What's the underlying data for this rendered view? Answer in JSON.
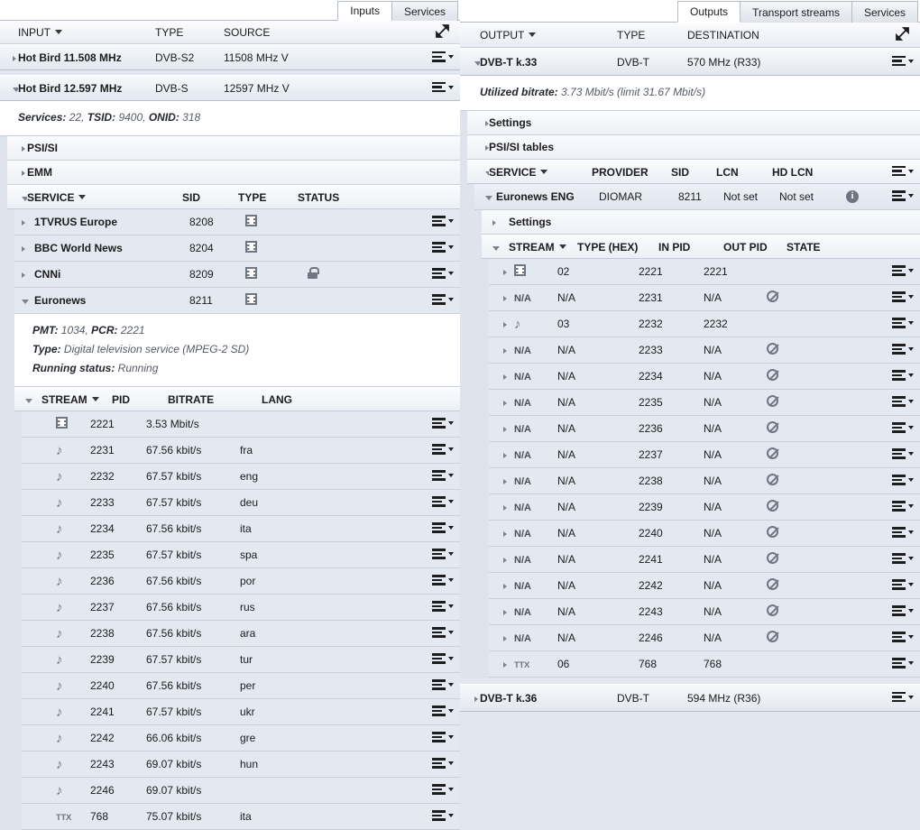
{
  "left": {
    "tabs": [
      {
        "label": "Inputs",
        "active": true
      },
      {
        "label": "Services",
        "active": false
      }
    ],
    "header": {
      "col_input": "INPUT",
      "col_type": "TYPE",
      "col_source": "SOURCE",
      "expand_icon": "expand-diagonal-icon"
    },
    "inputs": [
      {
        "name": "Hot Bird 11.508 MHz",
        "type": "DVB-S2",
        "source": "11508 MHz V",
        "expanded": false
      },
      {
        "name": "Hot Bird 12.597 MHz",
        "type": "DVB-S",
        "source": "12597 MHz V",
        "expanded": true
      }
    ],
    "ts_info": {
      "services_label": "Services:",
      "services_value": "22,",
      "tsid_label": "TSID:",
      "tsid_value": "9400,",
      "onid_label": "ONID:",
      "onid_value": "318"
    },
    "groups": [
      {
        "label": "PSI/SI"
      },
      {
        "label": "EMM"
      }
    ],
    "service_header": {
      "col_service": "SERVICE",
      "col_sid": "SID",
      "col_type": "TYPE",
      "col_status": "STATUS"
    },
    "services": [
      {
        "name": "1TVRUS Europe",
        "sid": "8208",
        "type_icon": "video-film-icon",
        "status_icon": "",
        "expanded": false
      },
      {
        "name": "BBC World News",
        "sid": "8204",
        "type_icon": "video-film-icon",
        "status_icon": "",
        "expanded": false
      },
      {
        "name": "CNNi",
        "sid": "8209",
        "type_icon": "video-film-icon",
        "status_icon": "lock-icon",
        "expanded": false
      },
      {
        "name": "Euronews",
        "sid": "8211",
        "type_icon": "video-film-icon",
        "status_icon": "",
        "expanded": true
      }
    ],
    "service_detail": {
      "pmt_label": "PMT:",
      "pmt_value": "1034,",
      "pcr_label": "PCR:",
      "pcr_value": "2221",
      "type_label": "Type:",
      "type_value": "Digital television service (MPEG-2 SD)",
      "running_label": "Running status:",
      "running_value": "Running"
    },
    "stream_header": {
      "col_stream": "STREAM",
      "col_pid": "PID",
      "col_bitrate": "BITRATE",
      "col_lang": "LANG"
    },
    "streams": [
      {
        "icon": "video-film-icon",
        "pid": "2221",
        "bitrate": "3.53 Mbit/s",
        "lang": ""
      },
      {
        "icon": "audio-note-icon",
        "pid": "2231",
        "bitrate": "67.56 kbit/s",
        "lang": "fra"
      },
      {
        "icon": "audio-note-icon",
        "pid": "2232",
        "bitrate": "67.57 kbit/s",
        "lang": "eng"
      },
      {
        "icon": "audio-note-icon",
        "pid": "2233",
        "bitrate": "67.57 kbit/s",
        "lang": "deu"
      },
      {
        "icon": "audio-note-icon",
        "pid": "2234",
        "bitrate": "67.56 kbit/s",
        "lang": "ita"
      },
      {
        "icon": "audio-note-icon",
        "pid": "2235",
        "bitrate": "67.57 kbit/s",
        "lang": "spa"
      },
      {
        "icon": "audio-note-icon",
        "pid": "2236",
        "bitrate": "67.56 kbit/s",
        "lang": "por"
      },
      {
        "icon": "audio-note-icon",
        "pid": "2237",
        "bitrate": "67.56 kbit/s",
        "lang": "rus"
      },
      {
        "icon": "audio-note-icon",
        "pid": "2238",
        "bitrate": "67.56 kbit/s",
        "lang": "ara"
      },
      {
        "icon": "audio-note-icon",
        "pid": "2239",
        "bitrate": "67.57 kbit/s",
        "lang": "tur"
      },
      {
        "icon": "audio-note-icon",
        "pid": "2240",
        "bitrate": "67.56 kbit/s",
        "lang": "per"
      },
      {
        "icon": "audio-note-icon",
        "pid": "2241",
        "bitrate": "67.57 kbit/s",
        "lang": "ukr"
      },
      {
        "icon": "audio-note-icon",
        "pid": "2242",
        "bitrate": "66.06 kbit/s",
        "lang": "gre"
      },
      {
        "icon": "audio-note-icon",
        "pid": "2243",
        "bitrate": "69.07 kbit/s",
        "lang": "hun"
      },
      {
        "icon": "audio-note-icon",
        "pid": "2246",
        "bitrate": "69.07 kbit/s",
        "lang": ""
      },
      {
        "icon": "ttx-icon",
        "pid": "768",
        "bitrate": "75.07 kbit/s",
        "lang": "ita"
      }
    ]
  },
  "right": {
    "tabs": [
      {
        "label": "Outputs",
        "active": true
      },
      {
        "label": "Transport streams",
        "active": false
      },
      {
        "label": "Services",
        "active": false
      }
    ],
    "header": {
      "col_output": "OUTPUT",
      "col_type": "TYPE",
      "col_destination": "DESTINATION",
      "expand_icon": "expand-diagonal-icon"
    },
    "output": {
      "name": "DVB-T k.33",
      "type": "DVB-T",
      "destination": "570 MHz (R33)",
      "expanded": true
    },
    "bitrate_info": {
      "label": "Utilized bitrate:",
      "value": "3.73 Mbit/s (limit 31.67 Mbit/s)"
    },
    "groups": [
      {
        "label": "Settings"
      },
      {
        "label": "PSI/SI tables"
      }
    ],
    "service_header": {
      "col_service": "SERVICE",
      "col_provider": "PROVIDER",
      "col_sid": "SID",
      "col_lcn": "LCN",
      "col_hdlcn": "HD LCN"
    },
    "service": {
      "name": "Euronews ENG",
      "provider": "DIOMAR",
      "sid": "8211",
      "lcn": "Not set",
      "hd_lcn": "Not set",
      "info_icon": "info-icon",
      "expanded": true
    },
    "service_settings_label": "Settings",
    "stream_header": {
      "col_stream": "STREAM",
      "col_type_hex": "TYPE (HEX)",
      "col_in_pid": "IN PID",
      "col_out_pid": "OUT PID",
      "col_state": "STATE"
    },
    "streams": [
      {
        "icon": "video-film-icon",
        "type_hex": "02",
        "in_pid": "2221",
        "out_pid": "2221",
        "state_icon": ""
      },
      {
        "icon": "na-text",
        "type_hex": "N/A",
        "in_pid": "2231",
        "out_pid": "N/A",
        "state_icon": "blocked-icon"
      },
      {
        "icon": "audio-note-icon",
        "type_hex": "03",
        "in_pid": "2232",
        "out_pid": "2232",
        "state_icon": ""
      },
      {
        "icon": "na-text",
        "type_hex": "N/A",
        "in_pid": "2233",
        "out_pid": "N/A",
        "state_icon": "blocked-icon"
      },
      {
        "icon": "na-text",
        "type_hex": "N/A",
        "in_pid": "2234",
        "out_pid": "N/A",
        "state_icon": "blocked-icon"
      },
      {
        "icon": "na-text",
        "type_hex": "N/A",
        "in_pid": "2235",
        "out_pid": "N/A",
        "state_icon": "blocked-icon"
      },
      {
        "icon": "na-text",
        "type_hex": "N/A",
        "in_pid": "2236",
        "out_pid": "N/A",
        "state_icon": "blocked-icon"
      },
      {
        "icon": "na-text",
        "type_hex": "N/A",
        "in_pid": "2237",
        "out_pid": "N/A",
        "state_icon": "blocked-icon"
      },
      {
        "icon": "na-text",
        "type_hex": "N/A",
        "in_pid": "2238",
        "out_pid": "N/A",
        "state_icon": "blocked-icon"
      },
      {
        "icon": "na-text",
        "type_hex": "N/A",
        "in_pid": "2239",
        "out_pid": "N/A",
        "state_icon": "blocked-icon"
      },
      {
        "icon": "na-text",
        "type_hex": "N/A",
        "in_pid": "2240",
        "out_pid": "N/A",
        "state_icon": "blocked-icon"
      },
      {
        "icon": "na-text",
        "type_hex": "N/A",
        "in_pid": "2241",
        "out_pid": "N/A",
        "state_icon": "blocked-icon"
      },
      {
        "icon": "na-text",
        "type_hex": "N/A",
        "in_pid": "2242",
        "out_pid": "N/A",
        "state_icon": "blocked-icon"
      },
      {
        "icon": "na-text",
        "type_hex": "N/A",
        "in_pid": "2243",
        "out_pid": "N/A",
        "state_icon": "blocked-icon"
      },
      {
        "icon": "na-text",
        "type_hex": "N/A",
        "in_pid": "2246",
        "out_pid": "N/A",
        "state_icon": "blocked-icon"
      },
      {
        "icon": "ttx-icon",
        "type_hex": "06",
        "in_pid": "768",
        "out_pid": "768",
        "state_icon": ""
      }
    ],
    "output2": {
      "name": "DVB-T k.36",
      "type": "DVB-T",
      "destination": "594 MHz (R36)",
      "expanded": false
    }
  },
  "colors": {
    "row_bg": "#e4e8f0",
    "header_bg": "#f4f6fa",
    "border": "#c9cfdb",
    "icon_gray": "#6e7681",
    "page_bg": "#e2e6ee"
  }
}
